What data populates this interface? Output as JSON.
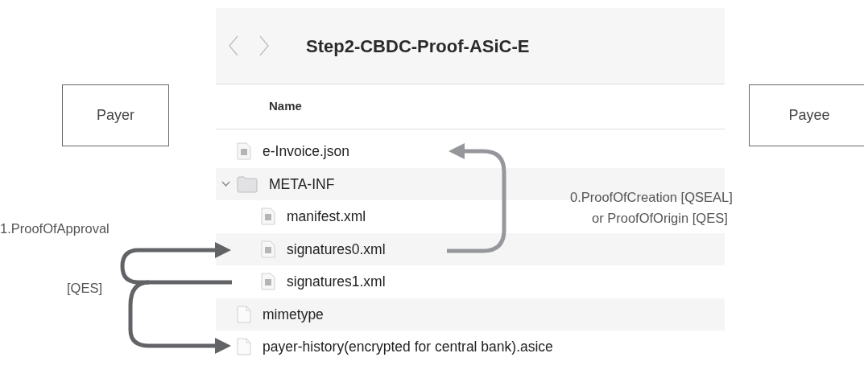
{
  "finder": {
    "title": "Step2-CBDC-Proof-ASiC-E",
    "column": "Name",
    "rows": [
      {
        "name": "e-Invoice.json",
        "kind": "file"
      },
      {
        "name": "META-INF",
        "kind": "folder",
        "expanded": true,
        "children": [
          {
            "name": "manifest.xml",
            "kind": "file"
          },
          {
            "name": "signatures0.xml",
            "kind": "file"
          },
          {
            "name": "signatures1.xml",
            "kind": "file"
          }
        ]
      },
      {
        "name": "mimetype",
        "kind": "plain"
      },
      {
        "name": "payer-history(encrypted for central bank).asice",
        "kind": "plain"
      }
    ]
  },
  "diagram": {
    "boxes": [
      {
        "label": "Payer"
      },
      {
        "label": "Payee"
      }
    ],
    "notes": [
      {
        "text": "0.ProofOfCreation [QSEAL]"
      },
      {
        "text": "or ProofOfOrigin [QES]"
      },
      {
        "text": "1.ProofOfApproval"
      },
      {
        "text": "[QES]"
      }
    ]
  }
}
